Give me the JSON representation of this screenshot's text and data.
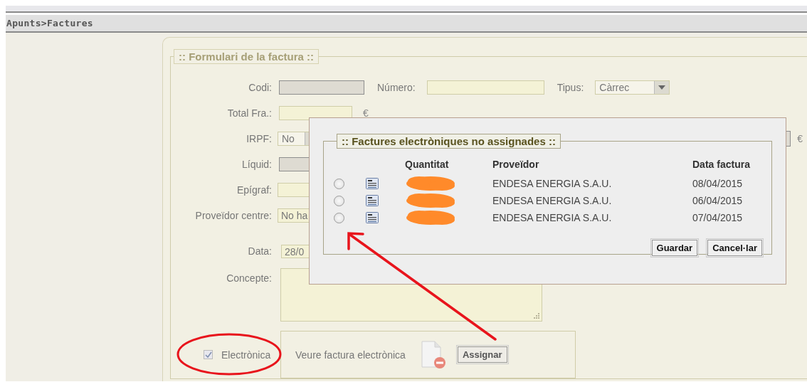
{
  "breadcrumb": "Apunts>Factures",
  "form": {
    "legend": ":: Formulari de la factura ::",
    "codi": {
      "label": "Codi:",
      "disabled": true
    },
    "numero": {
      "label": "Número:",
      "disabled": false
    },
    "tipus": {
      "label": "Tipus:",
      "value": "Càrrec"
    },
    "total": {
      "label": "Total Fra.:",
      "unit": "€",
      "disabled": false
    },
    "irpf": {
      "label": "IRPF:",
      "value": "No"
    },
    "side_unit": "€",
    "liquid": {
      "label": "Líquid:",
      "disabled": true
    },
    "epigraf": {
      "label": "Epígraf:",
      "disabled": false
    },
    "proveidor": {
      "label": "Proveïdor centre:",
      "value": "No ha"
    },
    "data": {
      "label": "Data:",
      "value": "28/0"
    },
    "concepte": {
      "label": "Concepte:"
    },
    "electronica": {
      "label": "Electrònica",
      "checked": true
    },
    "view_link": "Veure factura electrònica",
    "assign_button": "Assignar"
  },
  "dialog": {
    "legend": ":: Factures electròniques no assignades ::",
    "columns": [
      "Quantitat",
      "Proveïdor",
      "Data factura"
    ],
    "rows": [
      {
        "selected": false,
        "provider": "ENDESA ENERGIA S.A.U.",
        "date": "08/04/2015"
      },
      {
        "selected": false,
        "provider": "ENDESA ENERGIA S.A.U.",
        "date": "06/04/2015"
      },
      {
        "selected": false,
        "provider": "ENDESA ENERGIA S.A.U.",
        "date": "07/04/2015"
      }
    ],
    "buttons": [
      "Guardar",
      "Cancel·lar"
    ]
  }
}
